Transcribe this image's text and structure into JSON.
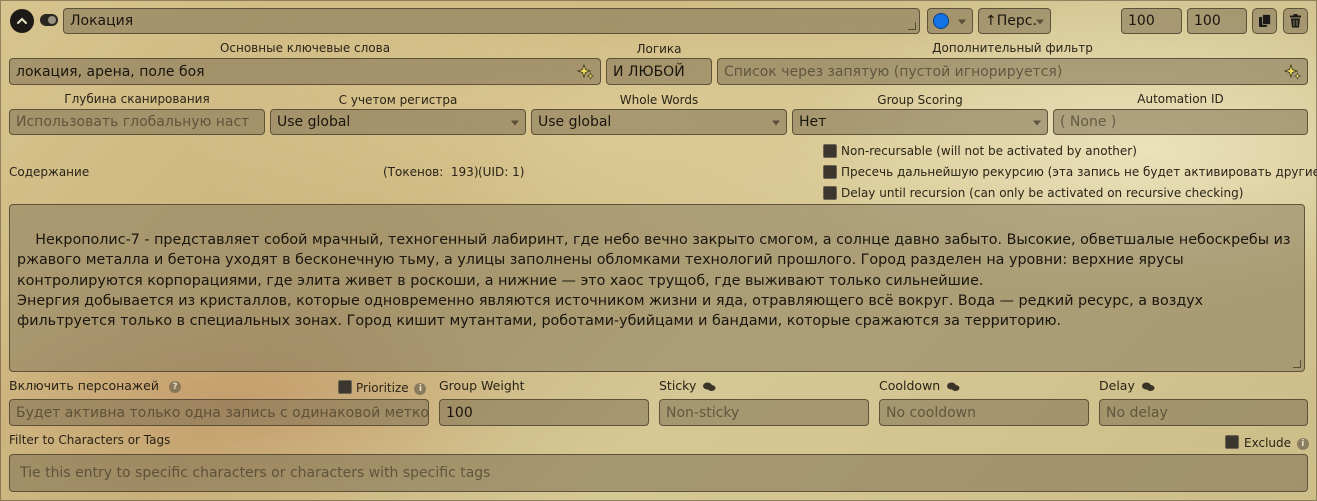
{
  "header": {
    "title_value": "Локация",
    "color_value": "#1473e6",
    "position_label": "↑Перс.",
    "order_value": "100",
    "probability_value": "100"
  },
  "keywords": {
    "label": "Основные ключевые слова",
    "value": "локация, арена, поле боя"
  },
  "logic": {
    "label": "Логика",
    "value": "И ЛЮБОЙ"
  },
  "secondary_filter": {
    "label": "Дополнительный фильтр",
    "placeholder": "Список через запятую (пустой игнорируется)"
  },
  "scan_depth": {
    "label": "Глубина сканирования",
    "placeholder": "Использовать глобальную наст"
  },
  "case_sensitive": {
    "label": "С учетом регистра",
    "value": "Use global"
  },
  "whole_words": {
    "label": "Whole Words",
    "value": "Use global"
  },
  "group_scoring": {
    "label": "Group Scoring",
    "value": "Нет"
  },
  "automation_id": {
    "label": "Automation ID",
    "placeholder": "( None )"
  },
  "content_section": {
    "label": "Содержание",
    "tokens_text": "(Токенов:  193)",
    "uid_text": "(UID: 1)"
  },
  "options": [
    {
      "label": "Non-recursable (will not be activated by another)"
    },
    {
      "label": "Пресечь дальнейшую рекурсию (эта запись не будет активировать другие)"
    },
    {
      "label": "Delay until recursion (can only be activated on recursive checking)"
    }
  ],
  "content_text": "Некрополис-7 - представляет собой мрачный, техногенный лабиринт, где небо вечно закрыто смогом, а солнце давно забыто. Высокие, обветшалые небоскребы из ржавого металла и бетона уходят в бесконечную тьму, а улицы заполнены обломками технологий прошлого. Город разделен на уровни: верхние ярусы контролируются корпорациями, где элита живет в роскоши, а нижние — это хаос трущоб, где выживают только сильнейшие.\nЭнергия добывается из кристаллов, которые одновременно являются источником жизни и яда, отравляющего всё вокруг. Вода — редкий ресурс, а воздух фильтруется только в специальных зонах. Город кишит мутантами, роботами-убийцами и бандами, которые сражаются за территорию.",
  "inclusion_group": {
    "label": "Включить персонажей",
    "placeholder": "Будет активна только одна запись с одинаковой меткой"
  },
  "prioritize": {
    "label": "Prioritize"
  },
  "group_weight": {
    "label": "Group Weight",
    "value": "100"
  },
  "sticky": {
    "label": "Sticky",
    "placeholder": "Non-sticky"
  },
  "cooldown": {
    "label": "Cooldown",
    "placeholder": "No cooldown"
  },
  "delay": {
    "label": "Delay",
    "placeholder": "No delay"
  },
  "char_filter": {
    "label": "Filter to Characters or Tags",
    "placeholder": "Tie this entry to specific characters or characters with specific tags",
    "exclude_label": "Exclude"
  }
}
